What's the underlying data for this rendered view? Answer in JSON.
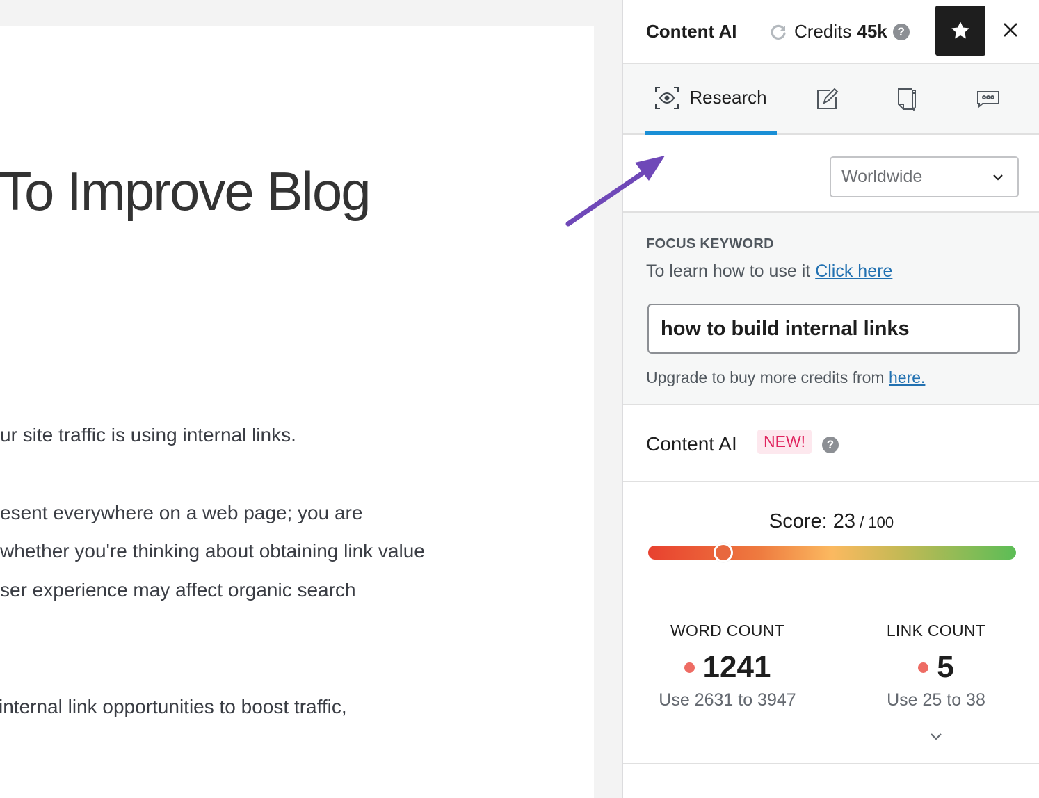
{
  "editor": {
    "post_title": "To Improve Blog",
    "paragraphs": [
      "ur site traffic is using internal links.",
      "esent everywhere on a web page; you are",
      "whether you're thinking about obtaining link value",
      "ser experience may affect organic search",
      " internal link opportunities to boost traffic,"
    ]
  },
  "panel": {
    "title": "Content AI",
    "credits_label": "Credits",
    "credits_value": "45k",
    "help_icon": "?",
    "tabs": [
      {
        "label": "Research",
        "icon": "eye-scan-icon",
        "active": true
      },
      {
        "label": "",
        "icon": "edit-icon",
        "active": false
      },
      {
        "label": "",
        "icon": "document-pen-icon",
        "active": false
      },
      {
        "label": "",
        "icon": "chat-bubble-icon",
        "active": false
      }
    ],
    "location_select": {
      "value": "Worldwide"
    },
    "focus_keyword": {
      "label": "FOCUS KEYWORD",
      "help_text": "To learn how to use it ",
      "help_link": "Click here",
      "value": "how to build internal links",
      "upgrade_text": "Upgrade to buy more credits from ",
      "upgrade_link": "here."
    },
    "content_ai_section": {
      "title": "Content AI",
      "badge": "NEW!"
    },
    "score": {
      "label": "Score: ",
      "value": "23",
      "max": " / 100",
      "percent": 23
    },
    "stats": [
      {
        "label": "WORD COUNT",
        "value": "1241",
        "hint": "Use 2631 to 3947"
      },
      {
        "label": "LINK COUNT",
        "value": "5",
        "hint": "Use 25 to 38"
      }
    ]
  },
  "colors": {
    "accent_tab": "#1a8fd6",
    "link": "#2271b1",
    "new_badge": "#e0245e",
    "status_dot": "#ee6c64",
    "annotation_arrow": "#6f48b8"
  }
}
